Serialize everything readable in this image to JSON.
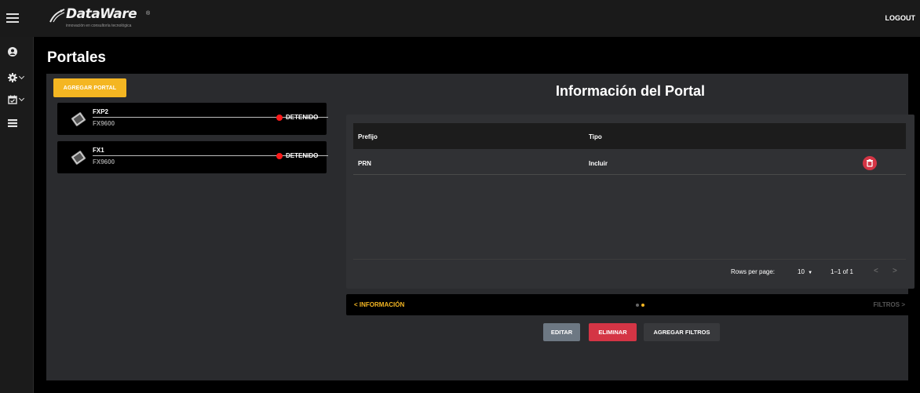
{
  "header": {
    "logo_text": "DataWare",
    "logo_registered": "®",
    "logo_tagline": "innovación en consultoría tecnológica",
    "logout_label": "LOGOUT"
  },
  "sidebar": {
    "items": [
      {
        "icon": "user-icon",
        "has_dropdown": false
      },
      {
        "icon": "gear-icon",
        "has_dropdown": true
      },
      {
        "icon": "calendar-check-icon",
        "has_dropdown": true
      },
      {
        "icon": "list-icon",
        "has_dropdown": false
      }
    ]
  },
  "page": {
    "title": "Portales",
    "add_button_label": "AGREGAR PORTAL"
  },
  "portals": [
    {
      "name": "FXP2",
      "model": "FX9600",
      "status": "DETENIDO",
      "icon": "reader-device-icon"
    },
    {
      "name": "FX1",
      "model": "FX9600",
      "status": "DETENIDO",
      "icon": "reader-device-icon"
    }
  ],
  "info": {
    "title": "Información del Portal",
    "table": {
      "headers": [
        "Prefijo",
        "Tipo"
      ],
      "rows": [
        {
          "prefijo": "PRN",
          "tipo": "Incluir"
        }
      ]
    },
    "pagination": {
      "rows_per_page_label": "Rows per page:",
      "rows_per_page_value": "10",
      "range_text": "1–1 of 1"
    },
    "stepper": {
      "back_label": "INFORMACIÓN",
      "next_label": "FILTROS",
      "steps": 2,
      "active_step": 2
    },
    "actions": {
      "edit_label": "EDITAR",
      "delete_label": "ELIMINAR",
      "add_filters_label": "AGREGAR FILTROS"
    }
  },
  "colors": {
    "accent": "#f4b622",
    "danger": "#d43545",
    "status_stopped": "#ff1a1a",
    "edit_button": "#6d7883"
  }
}
